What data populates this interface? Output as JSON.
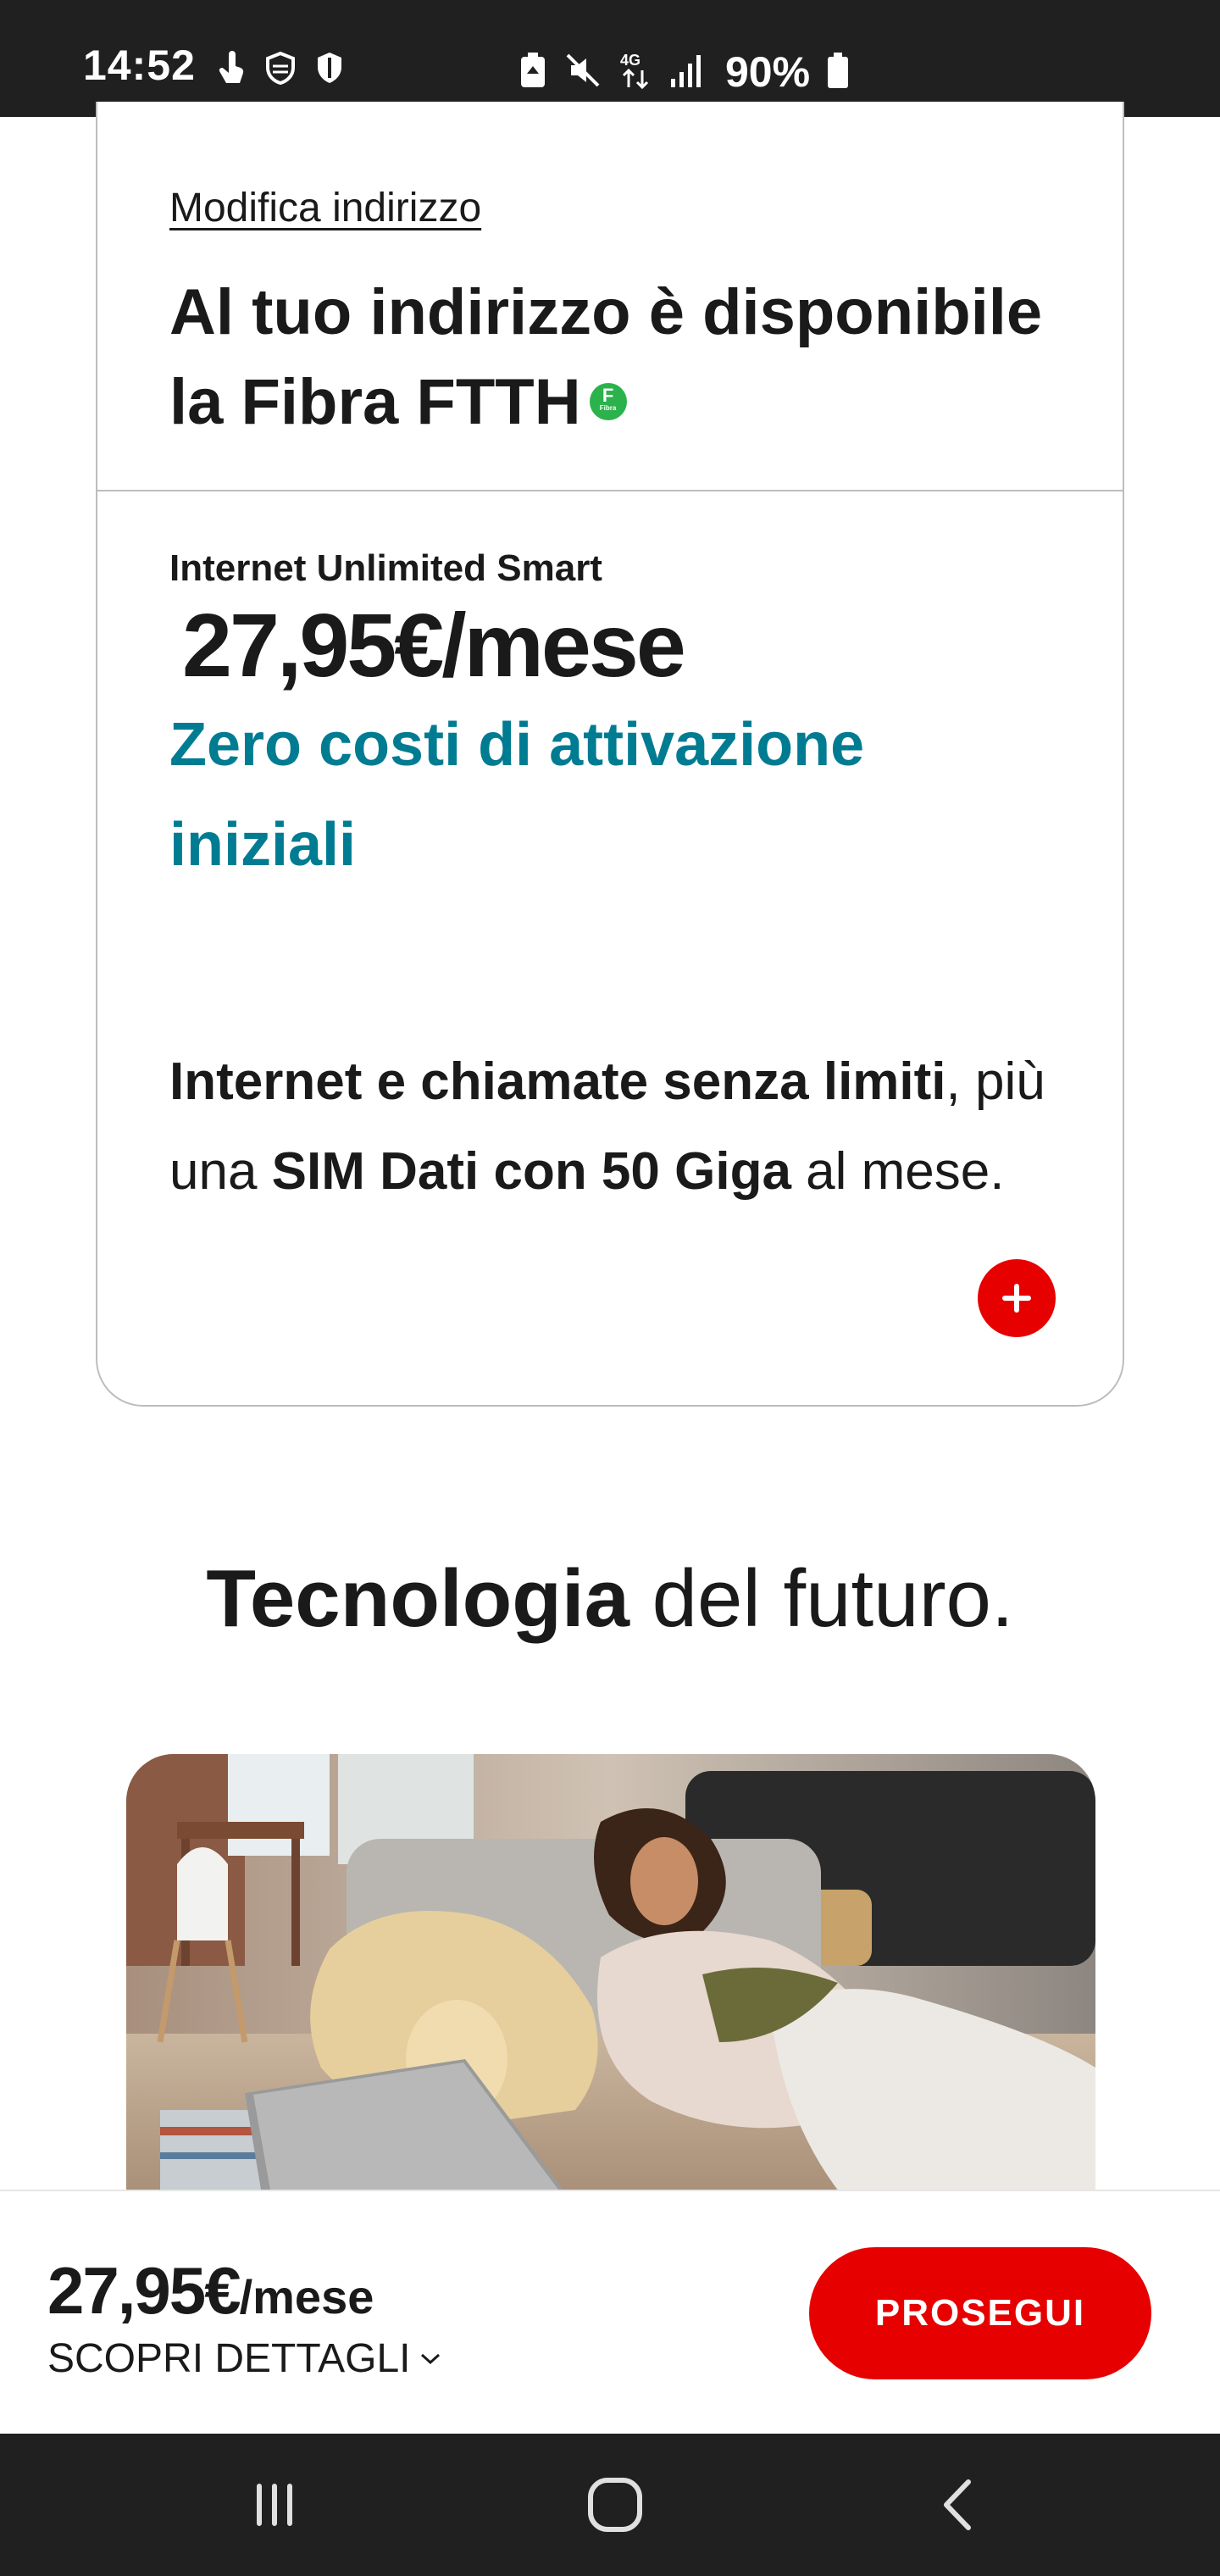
{
  "status_bar": {
    "time": "14:52",
    "left_icons": [
      "touch-icon",
      "shield-outline-icon",
      "shield-icon"
    ],
    "right_icons": [
      "battery-saver-icon",
      "mute-icon",
      "4g-data-icon",
      "signal-icon"
    ],
    "battery_percent": "90%"
  },
  "offer_card": {
    "modify_address_link": "Modifica indirizzo",
    "availability_title": "Al tuo indirizzo è disponibile la Fibra FTTH",
    "fibra_badge": {
      "letter": "F",
      "sub": "Fibra",
      "color": "#2bb24c"
    },
    "plan_name": "Internet Unlimited Smart",
    "plan_price": "27,95€/mese",
    "promo_text": "Zero costi di attivazione iniziali",
    "description": {
      "part1_bold": "Internet e chiamate senza limiti",
      "part2": ", più una ",
      "part3_bold": "SIM Dati con 50 Giga",
      "part4": " al mese."
    },
    "expand_icon": "plus-icon"
  },
  "section": {
    "title_bold": "Tecnologia",
    "title_rest": " del futuro."
  },
  "bottom_bar": {
    "price": "27,95€",
    "price_unit": "/mese",
    "details_link": "SCOPRI DETTAGLI",
    "proceed_button": "PROSEGUI"
  },
  "nav_bar": {
    "icons": [
      "recent-apps-icon",
      "home-icon",
      "back-icon"
    ]
  },
  "colors": {
    "accent_red": "#e60000",
    "promo_teal": "#007c92",
    "status_bar_bg": "#202020"
  }
}
